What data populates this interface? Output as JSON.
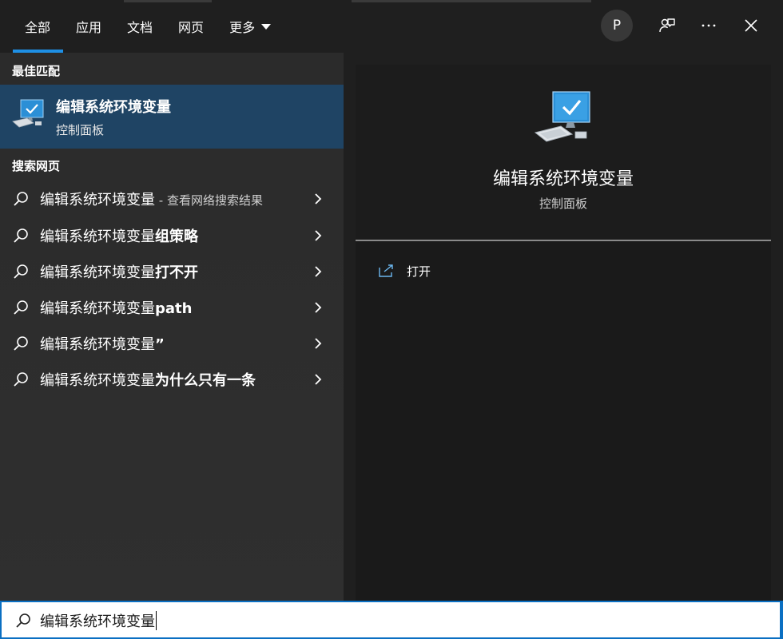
{
  "tabs": [
    {
      "label": "全部"
    },
    {
      "label": "应用"
    },
    {
      "label": "文档"
    },
    {
      "label": "网页"
    },
    {
      "label": "更多"
    }
  ],
  "avatar": {
    "initial": "P"
  },
  "icons": {
    "feedback": "feedback-icon",
    "more": "ellipsis-icon",
    "close": "close-icon",
    "search": "search-icon",
    "chevron": "chevron-right-icon",
    "open": "open-external-icon",
    "app": "control-panel-computer-icon"
  },
  "left": {
    "best_match_heading": "最佳匹配",
    "best_match": {
      "title": "编辑系统环境变量",
      "subtitle": "控制面板"
    },
    "web_heading": "搜索网页",
    "web_results": [
      {
        "prefix": "编辑系统环境变量",
        "bold": "",
        "hint": " - 查看网络搜索结果"
      },
      {
        "prefix": "编辑系统环境变量",
        "bold": "组策略",
        "hint": ""
      },
      {
        "prefix": "编辑系统环境变量",
        "bold": "打不开",
        "hint": ""
      },
      {
        "prefix": "编辑系统环境变量",
        "bold": "path",
        "hint": ""
      },
      {
        "prefix": "编辑系统环境变量",
        "bold": "”",
        "hint": ""
      },
      {
        "prefix": "编辑系统环境变量",
        "bold": "为什么只有一条",
        "hint": ""
      }
    ]
  },
  "right": {
    "title": "编辑系统环境变量",
    "subtitle": "控制面板",
    "actions": [
      {
        "label": "打开"
      }
    ]
  },
  "search": {
    "value": "编辑系统环境变量"
  },
  "colors": {
    "accent": "#1e90e6",
    "selected_row": "#1f4464",
    "search_border": "#0a6fc2"
  }
}
